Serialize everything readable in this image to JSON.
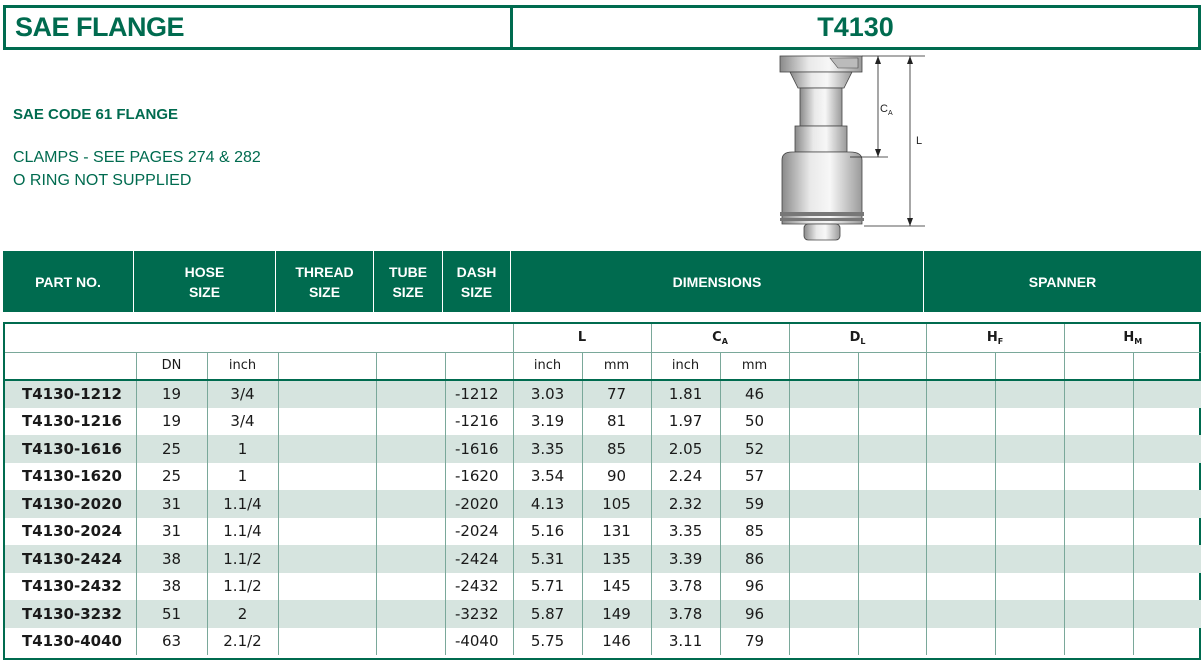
{
  "header": {
    "title": "SAE FLANGE",
    "code": "T4130"
  },
  "info": {
    "subtitle": "SAE CODE 61 FLANGE",
    "note1": "CLAMPS - SEE PAGES 274 & 282",
    "note2": "O RING NOT SUPPLIED"
  },
  "drawing": {
    "label_ca": "C",
    "label_ca_sub": "A",
    "label_l": "L"
  },
  "table": {
    "headers": {
      "part_no": "PART NO.",
      "hose_size_1": "HOSE",
      "hose_size_2": "SIZE",
      "thread_size_1": "THREAD",
      "thread_size_2": "SIZE",
      "tube_size_1": "TUBE",
      "tube_size_2": "SIZE",
      "dash_size_1": "DASH",
      "dash_size_2": "SIZE",
      "dimensions": "DIMENSIONS",
      "spanner": "SPANNER"
    },
    "dim_groups": {
      "l": "L",
      "ca": "C",
      "ca_sub": "A",
      "dl": "D",
      "dl_sub": "L",
      "hf": "H",
      "hf_sub": "F",
      "hm": "H",
      "hm_sub": "M"
    },
    "units": {
      "dn": "DN",
      "inch": "inch",
      "l_inch": "inch",
      "l_mm": "mm",
      "ca_inch": "inch",
      "ca_mm": "mm"
    },
    "rows": [
      {
        "part": "T4130-1212",
        "dn": "19",
        "inch": "3/4",
        "dash": "-1212",
        "l_in": "3.03",
        "l_mm": "77",
        "ca_in": "1.81",
        "ca_mm": "46"
      },
      {
        "part": "T4130-1216",
        "dn": "19",
        "inch": "3/4",
        "dash": "-1216",
        "l_in": "3.19",
        "l_mm": "81",
        "ca_in": "1.97",
        "ca_mm": "50"
      },
      {
        "part": "T4130-1616",
        "dn": "25",
        "inch": "1",
        "dash": "-1616",
        "l_in": "3.35",
        "l_mm": "85",
        "ca_in": "2.05",
        "ca_mm": "52"
      },
      {
        "part": "T4130-1620",
        "dn": "25",
        "inch": "1",
        "dash": "-1620",
        "l_in": "3.54",
        "l_mm": "90",
        "ca_in": "2.24",
        "ca_mm": "57"
      },
      {
        "part": "T4130-2020",
        "dn": "31",
        "inch": "1.1/4",
        "dash": "-2020",
        "l_in": "4.13",
        "l_mm": "105",
        "ca_in": "2.32",
        "ca_mm": "59"
      },
      {
        "part": "T4130-2024",
        "dn": "31",
        "inch": "1.1/4",
        "dash": "-2024",
        "l_in": "5.16",
        "l_mm": "131",
        "ca_in": "3.35",
        "ca_mm": "85"
      },
      {
        "part": "T4130-2424",
        "dn": "38",
        "inch": "1.1/2",
        "dash": "-2424",
        "l_in": "5.31",
        "l_mm": "135",
        "ca_in": "3.39",
        "ca_mm": "86"
      },
      {
        "part": "T4130-2432",
        "dn": "38",
        "inch": "1.1/2",
        "dash": "-2432",
        "l_in": "5.71",
        "l_mm": "145",
        "ca_in": "3.78",
        "ca_mm": "96"
      },
      {
        "part": "T4130-3232",
        "dn": "51",
        "inch": "2",
        "dash": "-3232",
        "l_in": "5.87",
        "l_mm": "149",
        "ca_in": "3.78",
        "ca_mm": "96"
      },
      {
        "part": "T4130-4040",
        "dn": "63",
        "inch": "2.1/2",
        "dash": "-4040",
        "l_in": "5.75",
        "l_mm": "146",
        "ca_in": "3.11",
        "ca_mm": "79"
      }
    ]
  }
}
